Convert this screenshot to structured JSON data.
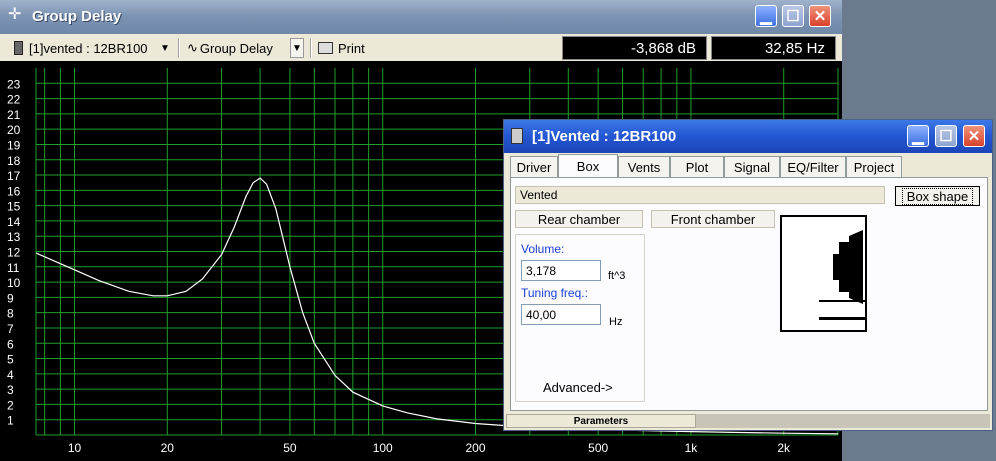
{
  "main_window": {
    "title": "Group Delay",
    "toolbar": {
      "project_select": "[1]vented : 12BR100",
      "plot_select": "Group Delay",
      "print_label": "Print",
      "readout_db": "-3,868 dB",
      "readout_hz": "32,85 Hz"
    }
  },
  "chart_data": {
    "type": "line",
    "xscale": "log",
    "xlim": [
      7.5,
      3000
    ],
    "ylim": [
      0,
      24
    ],
    "x_tick_labels": [
      {
        "v": 10,
        "t": "10"
      },
      {
        "v": 20,
        "t": "20"
      },
      {
        "v": 50,
        "t": "50"
      },
      {
        "v": 100,
        "t": "100"
      },
      {
        "v": 200,
        "t": "200"
      },
      {
        "v": 500,
        "t": "500"
      },
      {
        "v": 1000,
        "t": "1k"
      },
      {
        "v": 2000,
        "t": "2k"
      }
    ],
    "y_ticks": [
      1,
      2,
      3,
      4,
      5,
      6,
      7,
      8,
      9,
      10,
      11,
      12,
      13,
      14,
      15,
      16,
      17,
      18,
      19,
      20,
      21,
      22,
      23
    ],
    "grid": true,
    "grid_color": "#1f9e2a",
    "line_color": "#ffffff",
    "series": [
      {
        "x": [
          7.5,
          9,
          10,
          12,
          15,
          18,
          20,
          23,
          26,
          30,
          33,
          36,
          38,
          40,
          42,
          45,
          50,
          55,
          60,
          70,
          80,
          100,
          120,
          150,
          200,
          300,
          500,
          1000,
          2000,
          3000
        ],
        "y": [
          11.9,
          11.2,
          10.8,
          10.1,
          9.4,
          9.1,
          9.1,
          9.4,
          10.2,
          11.8,
          13.6,
          15.6,
          16.5,
          16.8,
          16.4,
          14.8,
          11.0,
          8.0,
          6.0,
          3.9,
          2.8,
          1.9,
          1.45,
          1.05,
          0.75,
          0.5,
          0.35,
          0.22,
          0.12,
          0.08
        ]
      }
    ]
  },
  "dialog": {
    "title": "[1]Vented :  12BR100",
    "tabs": [
      "Driver",
      "Box",
      "Vents",
      "Plot",
      "Signal",
      "EQ/Filter",
      "Project"
    ],
    "active_tab": "Box",
    "box_type": "Vented",
    "box_shape_button": "Box shape",
    "rear_chamber_button": "Rear chamber",
    "front_chamber_button": "Front chamber",
    "volume_label": "Volume:",
    "volume_value": "3,178",
    "volume_unit": "ft^3",
    "tuning_label": "Tuning freq.:",
    "tuning_value": "40,00",
    "tuning_unit": "Hz",
    "advanced_label": "Advanced->",
    "status_tab": "Parameters"
  },
  "colors": {
    "label_blue": "#1a3fd6",
    "plot_bg": "#000000"
  }
}
